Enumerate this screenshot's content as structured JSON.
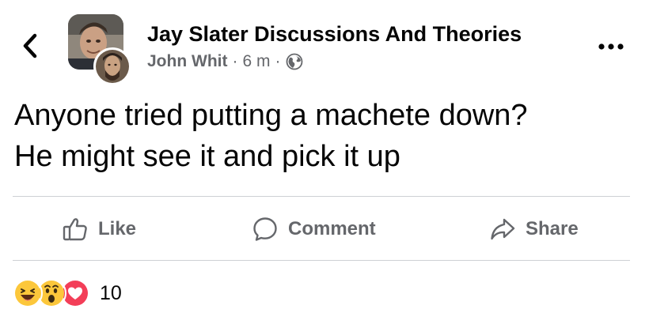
{
  "header": {
    "back_icon": "chevron-left-icon",
    "group_name": "Jay Slater Discussions And Theories",
    "author": "John Whit",
    "separator": "·",
    "time": "6 m",
    "privacy_icon": "globe-icon",
    "more_icon": "more-horizontal-icon"
  },
  "post": {
    "text_line1": "Anyone tried putting a machete down?",
    "text_line2": "He might see it and pick it up"
  },
  "actions": {
    "like": "Like",
    "comment": "Comment",
    "share": "Share"
  },
  "reactions": {
    "types": [
      "haha",
      "wow",
      "love"
    ],
    "count": "10"
  },
  "colors": {
    "text": "#050505",
    "muted": "#65676b",
    "divider": "#ced0d4",
    "love": "#f33e58",
    "emoji": "#fcc73b"
  }
}
